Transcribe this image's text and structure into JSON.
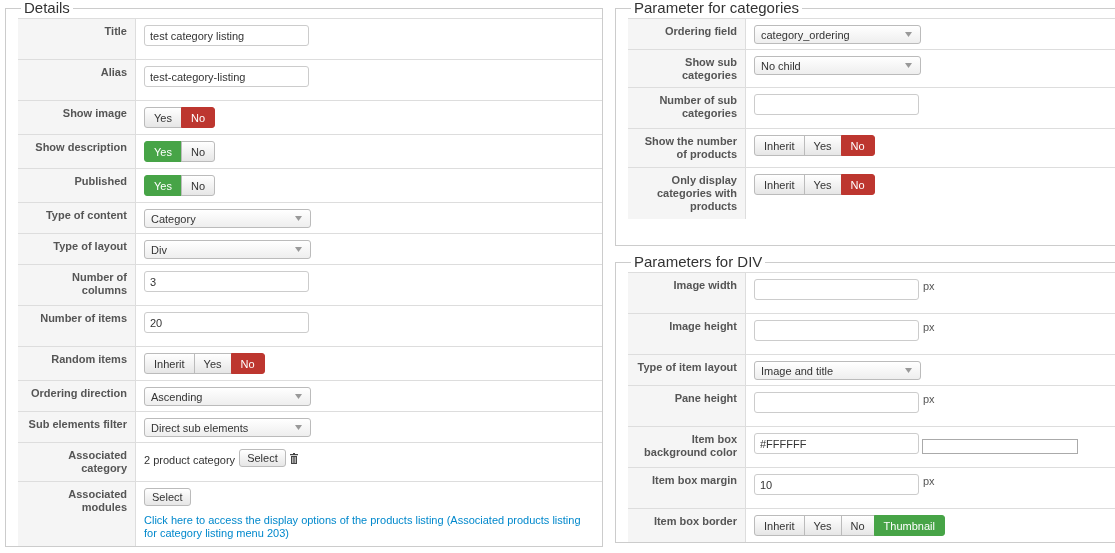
{
  "details": {
    "legend": "Details",
    "rows": [
      {
        "label": "Title",
        "kind": "text",
        "value": "test category listing"
      },
      {
        "label": "Alias",
        "kind": "text",
        "value": "test-category-listing"
      },
      {
        "label": "Show image",
        "kind": "toggle",
        "options": [
          {
            "label": "Yes",
            "selected": false
          },
          {
            "label": "No",
            "selected": true,
            "color": "#bd362f"
          }
        ]
      },
      {
        "label": "Show description",
        "kind": "toggle",
        "options": [
          {
            "label": "Yes",
            "selected": true,
            "color": "#47a447"
          },
          {
            "label": "No",
            "selected": false
          }
        ]
      },
      {
        "label": "Published",
        "kind": "toggle",
        "options": [
          {
            "label": "Yes",
            "selected": true,
            "color": "#47a447"
          },
          {
            "label": "No",
            "selected": false
          }
        ]
      },
      {
        "label": "Type of content",
        "kind": "select",
        "value": "Category"
      },
      {
        "label": "Type of layout",
        "kind": "select",
        "value": "Div"
      },
      {
        "label": "Number of columns",
        "kind": "text",
        "value": "3"
      },
      {
        "label": "Number of items",
        "kind": "text",
        "value": "20"
      },
      {
        "label": "Random items",
        "kind": "toggle",
        "options": [
          {
            "label": "Inherit",
            "selected": false
          },
          {
            "label": "Yes",
            "selected": false
          },
          {
            "label": "No",
            "selected": true,
            "color": "#bd362f"
          }
        ]
      },
      {
        "label": "Ordering direction",
        "kind": "select",
        "value": "Ascending"
      },
      {
        "label": "Sub elements filter",
        "kind": "select",
        "value": "Direct sub elements"
      },
      {
        "label": "Associated category",
        "kind": "picker",
        "value": "2 product category",
        "button": "Select"
      },
      {
        "label": "Associated modules",
        "kind": "modules",
        "button": "Select",
        "link": "Click here to access the display options of the products listing (Associated products listing for category listing menu 203)"
      }
    ]
  },
  "categories": {
    "legend": "Parameter for categories",
    "rows": [
      {
        "label": "Ordering field",
        "kind": "select",
        "value": "category_ordering"
      },
      {
        "label": "Show sub categories",
        "kind": "select",
        "value": "No child"
      },
      {
        "label": "Number of sub categories",
        "kind": "text"
      },
      {
        "label": "Show the number of products",
        "kind": "toggle",
        "options": [
          {
            "label": "Inherit",
            "selected": false
          },
          {
            "label": "Yes",
            "selected": false
          },
          {
            "label": "No",
            "selected": true,
            "color": "#bd362f"
          }
        ]
      },
      {
        "label": "Only display categories with products",
        "kind": "toggle",
        "options": [
          {
            "label": "Inherit",
            "selected": false
          },
          {
            "label": "Yes",
            "selected": false
          },
          {
            "label": "No",
            "selected": true,
            "color": "#bd362f"
          }
        ]
      }
    ]
  },
  "div_params": {
    "legend": "Parameters for DIV",
    "rows": [
      {
        "label": "Image width",
        "kind": "text",
        "unit": "px"
      },
      {
        "label": "Image height",
        "kind": "text",
        "unit": "px"
      },
      {
        "label": "Type of item layout",
        "kind": "select",
        "value": "Image and title"
      },
      {
        "label": "Pane height",
        "kind": "text",
        "unit": "px"
      },
      {
        "label": "Item box background color",
        "kind": "color",
        "value": "#FFFFFF"
      },
      {
        "label": "Item box margin",
        "kind": "text",
        "value": "10",
        "unit": "px"
      },
      {
        "label": "Item box border",
        "kind": "toggle",
        "options": [
          {
            "label": "Inherit",
            "selected": false
          },
          {
            "label": "Yes",
            "selected": false
          },
          {
            "label": "No",
            "selected": false
          },
          {
            "label": "Thumbnail",
            "selected": true,
            "color": "#47a447"
          }
        ]
      }
    ]
  }
}
